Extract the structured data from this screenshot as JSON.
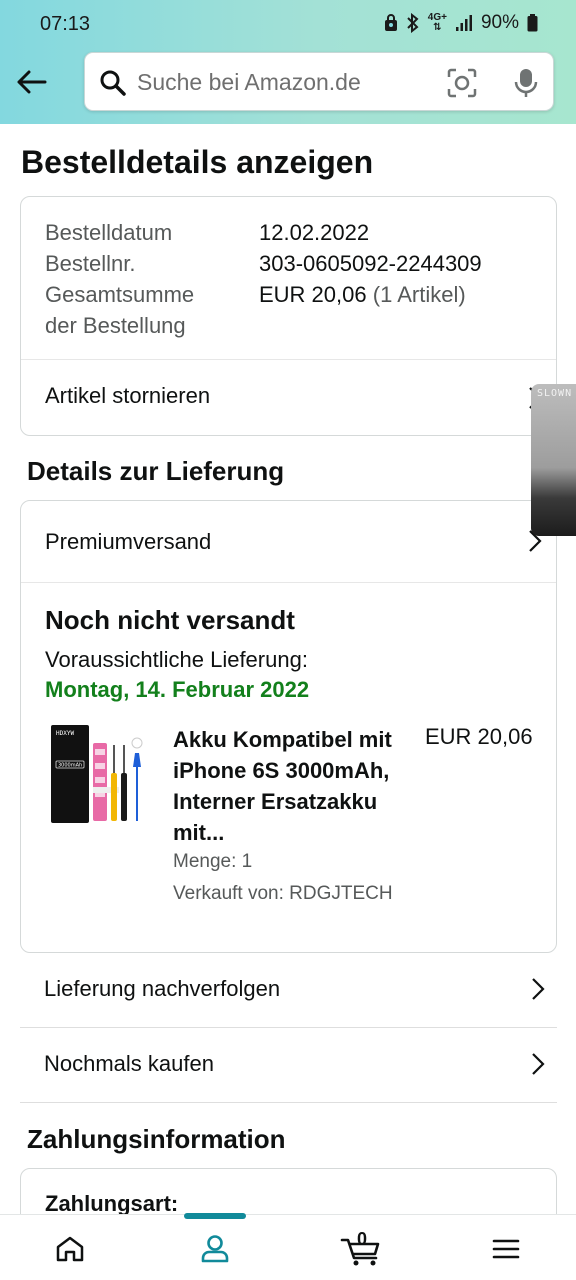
{
  "status_bar": {
    "time": "07:13",
    "network": "4G+",
    "battery": "90%"
  },
  "header": {
    "search_placeholder": "Suche bei Amazon.de",
    "icons": [
      "back-arrow-icon",
      "search-icon",
      "camera-icon",
      "microphone-icon"
    ]
  },
  "page": {
    "title": "Bestelldetails anzeigen"
  },
  "order": {
    "date_label": "Bestelldatum",
    "date_value": "12.02.2022",
    "number_label": "Bestellnr.",
    "number_value": "303-0605092-2244309",
    "total_label_line1": "Gesamtsumme",
    "total_label_line2": "der Bestellung",
    "total_value": "EUR 20,06",
    "total_items": "(1 Artikel)",
    "cancel_label": "Artikel stornieren"
  },
  "delivery": {
    "section_title": "Details zur Lieferung",
    "shipping_method": "Premiumversand",
    "status": "Noch nicht versandt",
    "eta_label": "Voraussichtliche Lieferung:",
    "eta_date": "Montag, 14. Februar 2022",
    "eta_color": "#13801c",
    "product": {
      "title": "Akku Kompatibel mit iPhone 6S 3000mAh, Interner Ersatzakku mit...",
      "price": "EUR 20,06",
      "quantity": "Menge: 1",
      "seller": "Verkauft von: RDGJTECH",
      "image_brand_text": "HDXYW",
      "image_capacity_text": "3000mAh"
    }
  },
  "actions": {
    "track": "Lieferung nachverfolgen",
    "buy_again": "Nochmals kaufen"
  },
  "payment": {
    "section_title": "Zahlungsinformation",
    "method_label": "Zahlungsart:"
  },
  "floating_thumbnail": {
    "text": "SLOWN"
  },
  "bottom_nav": {
    "cart_count": "0",
    "active_tab": "account",
    "accent_color": "#118a9a"
  }
}
